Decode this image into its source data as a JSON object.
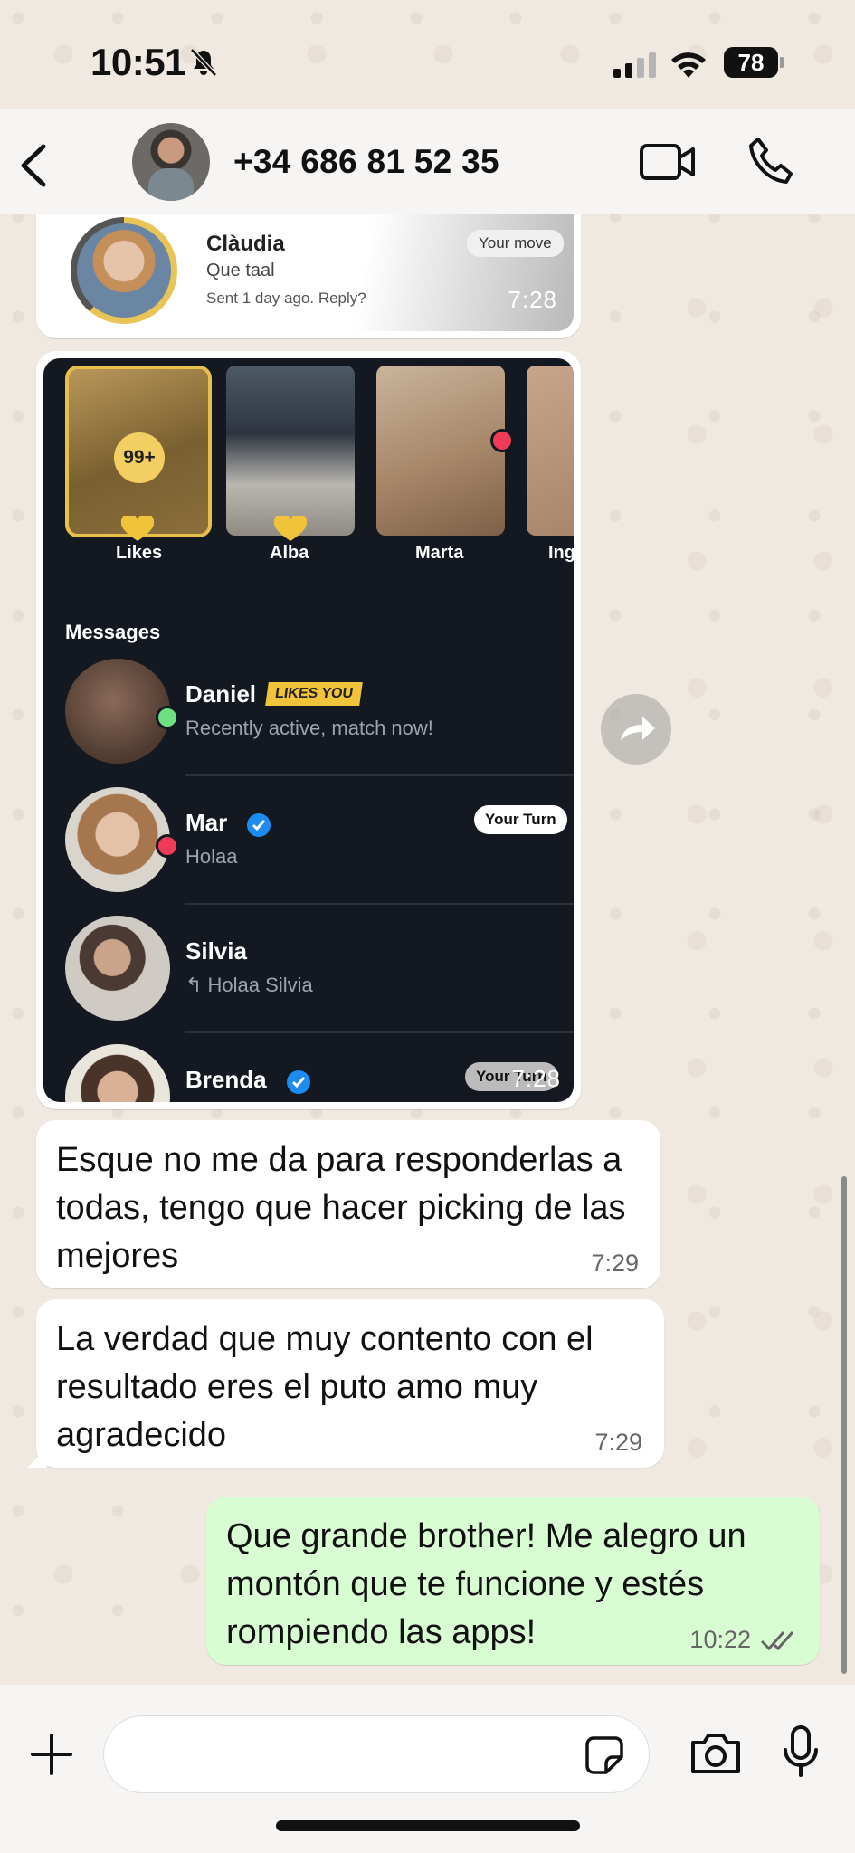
{
  "status_bar": {
    "time": "10:51",
    "battery": "78"
  },
  "header": {
    "contact_name": "+34 686 81 52 35"
  },
  "messages": {
    "image_1": {
      "match_name": "Clàudia",
      "match_text": "Que taal",
      "match_sub": "Sent 1 day ago. Reply?",
      "badge": "Your move",
      "time": "7:28"
    },
    "image_2": {
      "stories": [
        {
          "label": "Likes",
          "count": "99+"
        },
        {
          "label": "Alba"
        },
        {
          "label": "Marta"
        },
        {
          "label": "Ingr"
        }
      ],
      "section_title": "Messages",
      "conversations": [
        {
          "name": "Daniel",
          "badge": "LIKES YOU",
          "preview": "Recently active, match now!"
        },
        {
          "name": "Mar",
          "badge": "Your Turn",
          "preview": "Holaa"
        },
        {
          "name": "Silvia",
          "preview": "Holaa Silvia"
        },
        {
          "name": "Brenda",
          "badge": "Your Turn"
        }
      ],
      "time": "7:28"
    },
    "incoming_1": {
      "text": "Esque no me da para responderlas a todas, tengo que hacer picking de las mejores",
      "time": "7:29"
    },
    "incoming_2": {
      "text": "La verdad que muy contento con el resultado eres el puto amo muy agradecido",
      "time": "7:29"
    },
    "outgoing_1": {
      "text": "Que grande brother! Me alegro un montón que te funcione y estés rompiendo las apps!",
      "time": "10:22"
    }
  },
  "input": {
    "value": "",
    "placeholder": ""
  },
  "icons": {
    "back": "chevron-left-icon",
    "video": "video-camera-icon",
    "phone": "phone-icon",
    "plus": "plus-icon",
    "sticker": "sticker-icon",
    "camera": "camera-icon",
    "mic": "microphone-icon",
    "forward": "forward-arrow-icon",
    "read_status": "double-check-icon"
  },
  "colors": {
    "outgoing_bubble": "#d9fdd3",
    "incoming_bubble": "#ffffff",
    "app_dark_bg": "#141821",
    "likes_gold": "#e7c04c",
    "online_green": "#6ee07f",
    "unread_red": "#ef3b57",
    "verified_blue": "#1d8cf0"
  }
}
